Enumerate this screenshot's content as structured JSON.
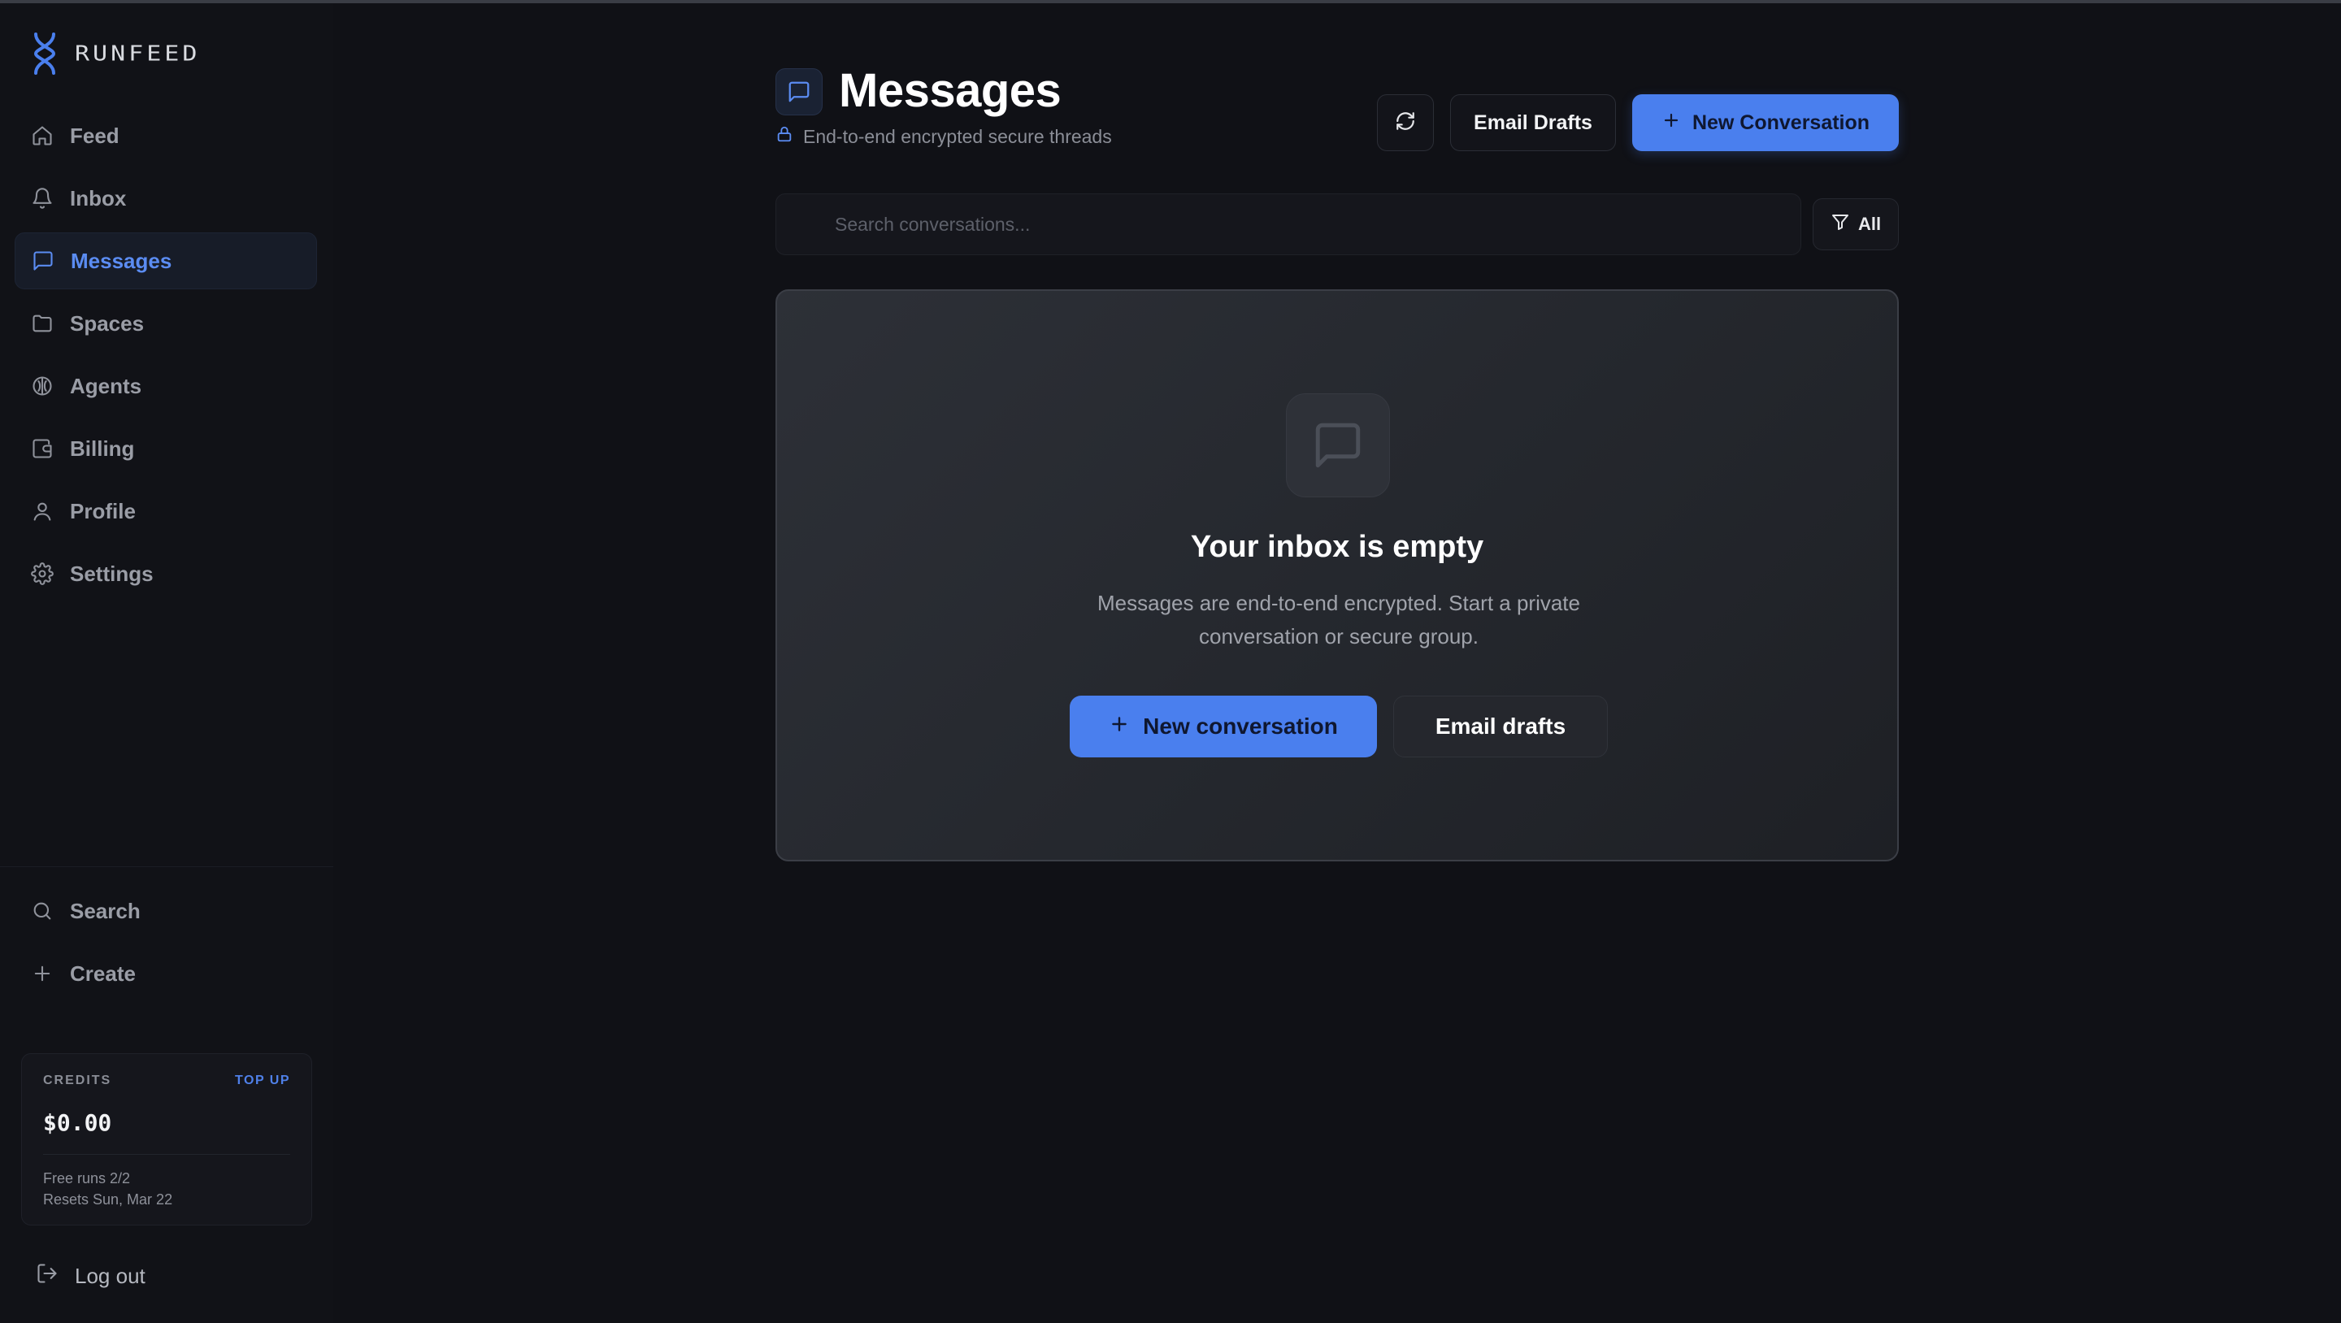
{
  "app": {
    "brand": "RUNFEED",
    "accent_color": "#4a7fee"
  },
  "sidebar": {
    "items": [
      {
        "label": "Feed",
        "icon": "home-icon"
      },
      {
        "label": "Inbox",
        "icon": "bell-icon"
      },
      {
        "label": "Messages",
        "icon": "message-square-icon",
        "active": true
      },
      {
        "label": "Spaces",
        "icon": "folder-icon"
      },
      {
        "label": "Agents",
        "icon": "agents-icon"
      },
      {
        "label": "Billing",
        "icon": "wallet-icon"
      },
      {
        "label": "Profile",
        "icon": "user-icon"
      },
      {
        "label": "Settings",
        "icon": "gear-icon"
      }
    ],
    "bottom_items": [
      {
        "label": "Search",
        "icon": "search-icon"
      },
      {
        "label": "Create",
        "icon": "plus-icon"
      }
    ],
    "credits": {
      "label": "CREDITS",
      "top_up_label": "TOP UP",
      "amount": "$0.00",
      "free_runs": "Free runs 2/2",
      "resets": "Resets Sun, Mar 22"
    },
    "logout_label": "Log out"
  },
  "header": {
    "title": "Messages",
    "subtitle": "End-to-end encrypted secure threads",
    "email_drafts_label": "Email Drafts",
    "new_conversation_label": "New Conversation"
  },
  "search": {
    "placeholder": "Search conversations...",
    "filter_label": "All"
  },
  "empty_state": {
    "title": "Your inbox is empty",
    "description": "Messages are end-to-end encrypted. Start a private conversation or secure group.",
    "new_conversation_label": "New conversation",
    "email_drafts_label": "Email drafts"
  }
}
